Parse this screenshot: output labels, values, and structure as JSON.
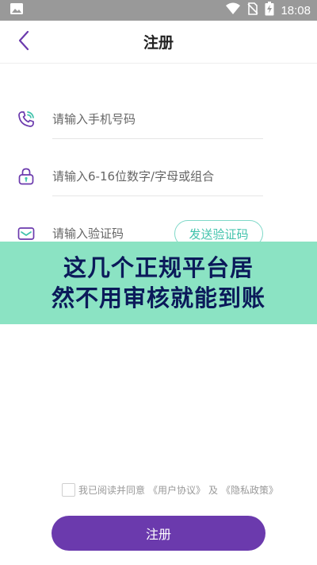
{
  "status_bar": {
    "time": "18:08",
    "icons": [
      "image-icon",
      "wifi-icon",
      "no-sim-icon",
      "battery-charging-icon"
    ]
  },
  "header": {
    "title": "注册",
    "back_icon": "chevron-left-icon"
  },
  "form": {
    "phone": {
      "icon": "phone-icon",
      "placeholder": "请输入手机号码",
      "value": ""
    },
    "password": {
      "icon": "lock-icon",
      "placeholder": "请输入6-16位数字/字母或组合",
      "value": ""
    },
    "code": {
      "icon": "mail-icon",
      "placeholder": "请输入验证码",
      "value": "",
      "send_label": "发送验证码"
    }
  },
  "banner": {
    "line1": "这几个正规平台居",
    "line2": "然不用审核就能到账"
  },
  "agreement": {
    "prefix": "我已阅读并同意",
    "user_agreement": "《用户协议》",
    "and": "及",
    "privacy_policy": "《隐私政策》",
    "checked": false
  },
  "submit": {
    "label": "注册"
  },
  "colors": {
    "accent": "#6b3aad",
    "teal": "#42c3ac",
    "banner_bg": "#8be3c3",
    "banner_text": "#0b1a5a",
    "status_bar": "#999999"
  }
}
